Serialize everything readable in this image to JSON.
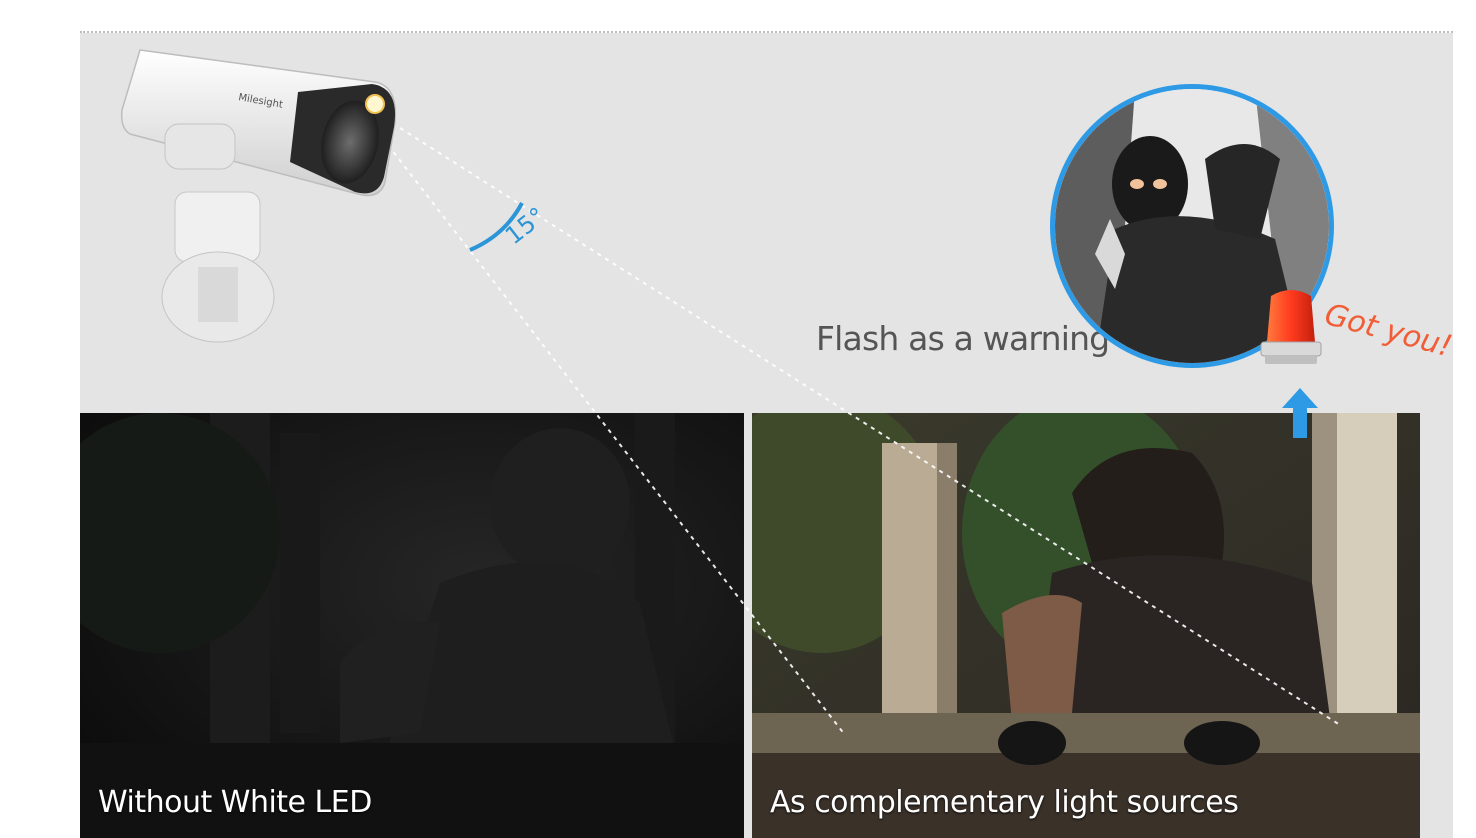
{
  "camera": {
    "brand_mark": "Milesight"
  },
  "angle": {
    "label": "15°"
  },
  "warning": {
    "label": "Flash as a warning",
    "exclamation": "Got you!"
  },
  "panels": {
    "left_caption": "Without White LED",
    "right_caption": "As complementary light sources"
  },
  "colors": {
    "panel_background": "#e4e4e4",
    "accent_blue": "#2e9ae6",
    "alert_orange": "#f05d36",
    "label_gray": "#555555"
  },
  "icons": {
    "arrow": "up-arrow-icon",
    "siren": "siren-icon"
  }
}
